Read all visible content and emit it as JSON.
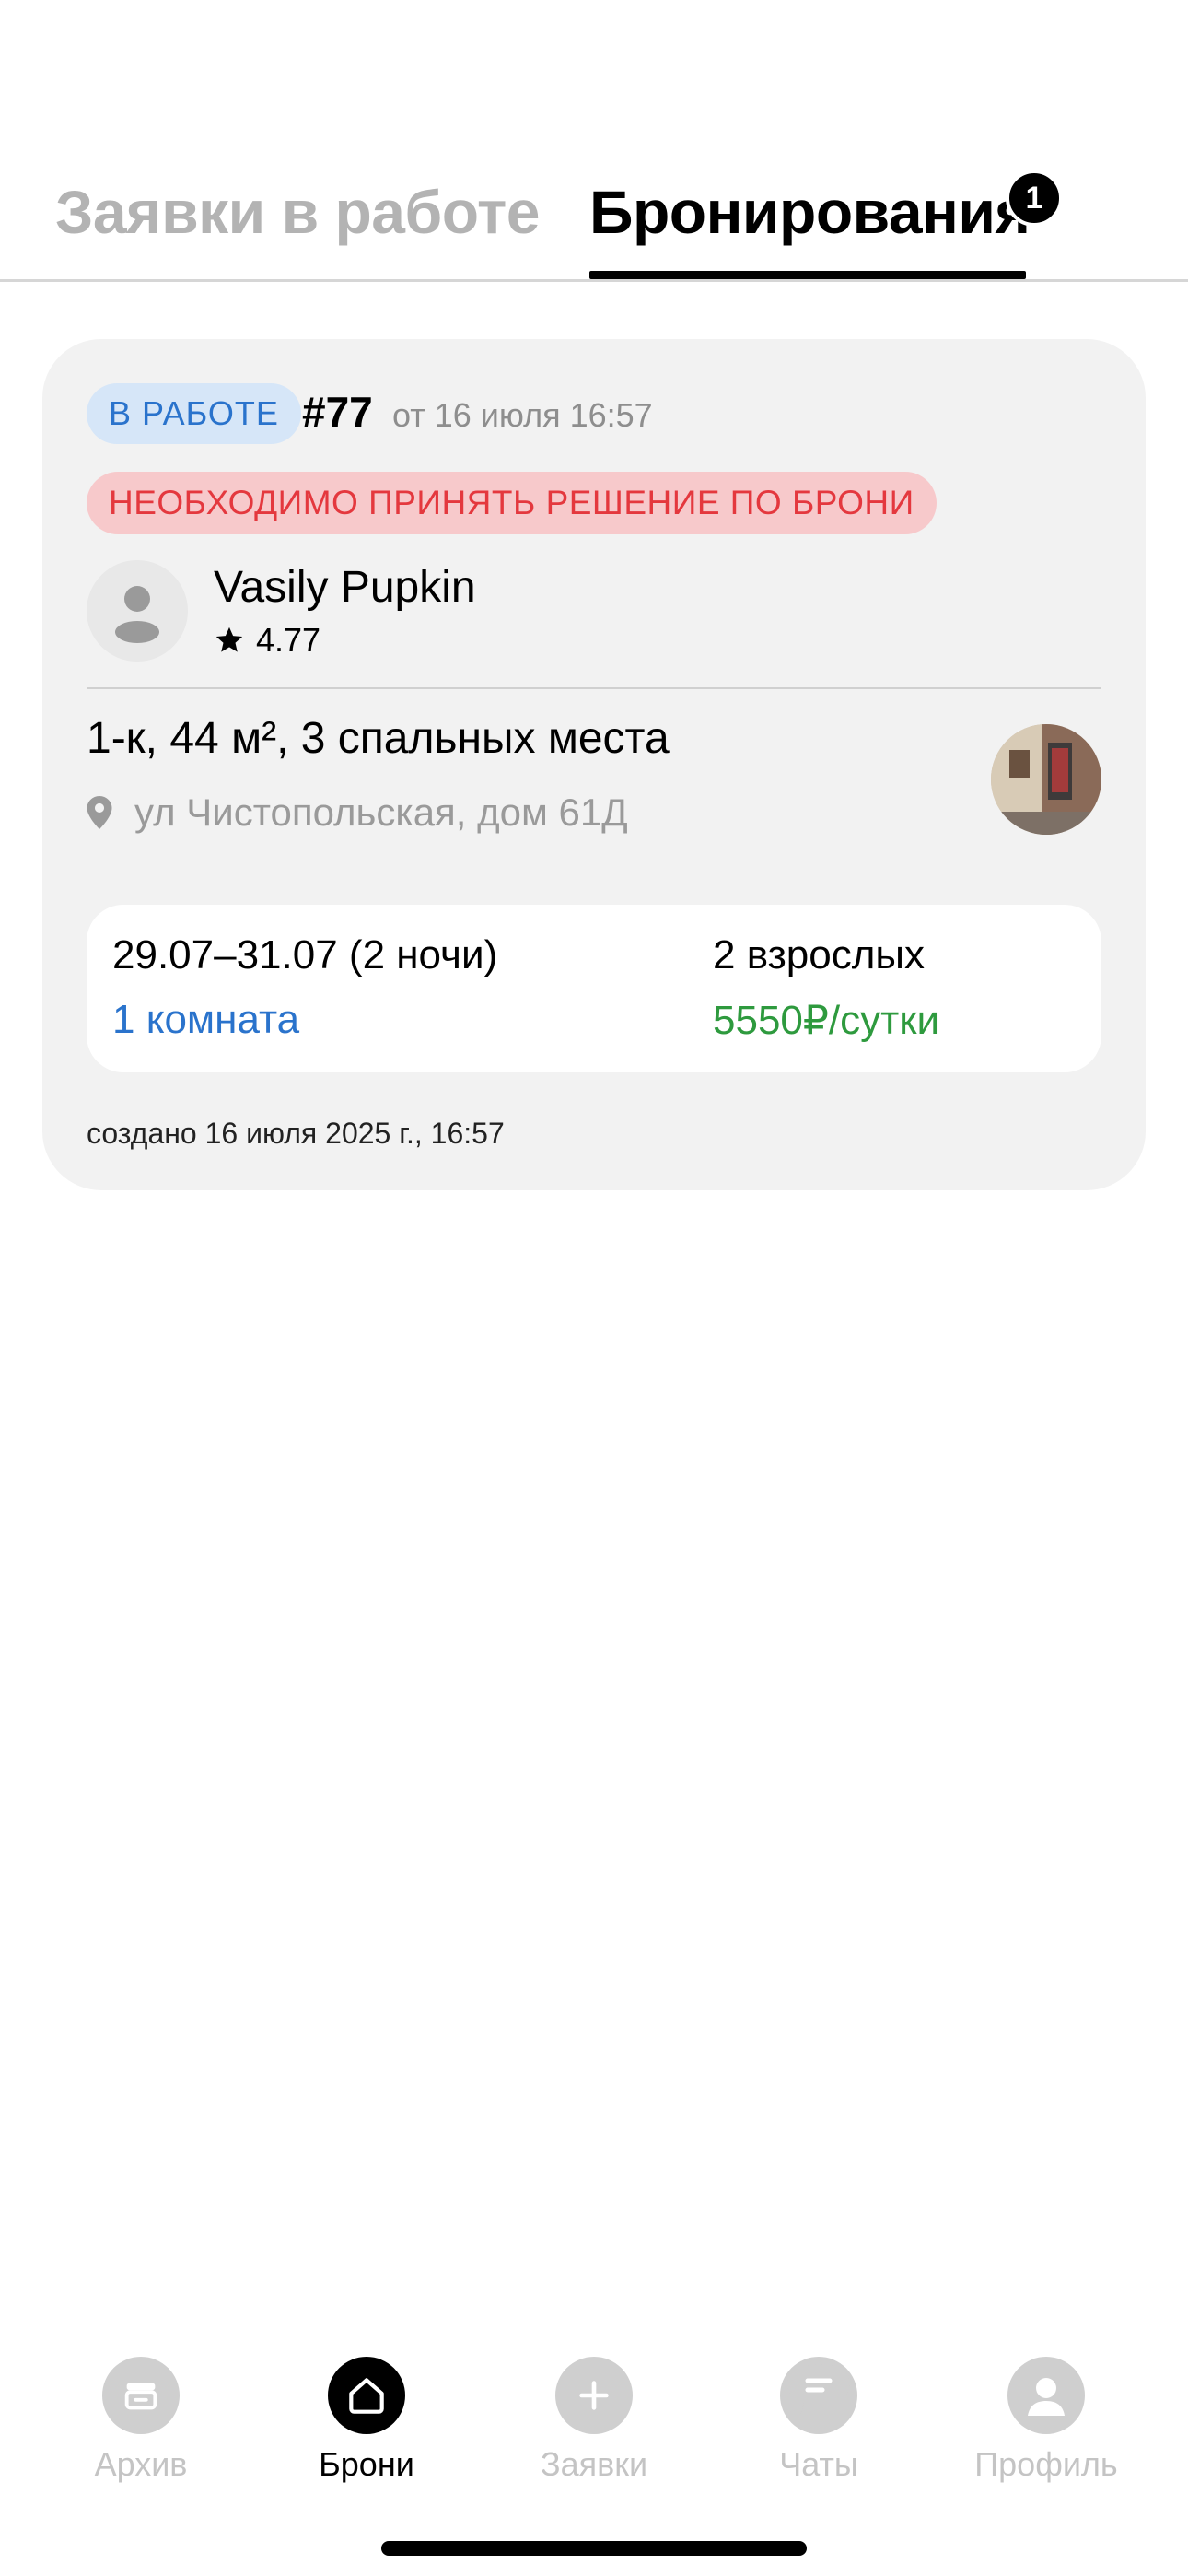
{
  "tabs": {
    "requests_label": "Заявки в работе",
    "bookings_label": "Бронирования",
    "bookings_badge": "1"
  },
  "booking": {
    "status": "В РАБОТЕ",
    "number": "#77",
    "date": "от 16 июля 16:57",
    "alert": "НЕОБХОДИМО ПРИНЯТЬ РЕШЕНИЕ ПО БРОНИ",
    "guest_name": "Vasily Pupkin",
    "guest_rating": "4.77",
    "apartment_title": "1-к, 44 м², 3 спальных места",
    "apartment_address": "ул Чистопольская, дом 61Д",
    "dates": "29.07–31.07 (2 ночи)",
    "guests": "2 взрослых",
    "rooms": "1 комната",
    "price": "5550₽/сутки",
    "created": "создано 16 июля 2025 г., 16:57"
  },
  "nav": {
    "archive": "Архив",
    "bookings": "Брони",
    "requests": "Заявки",
    "chats": "Чаты",
    "profile": "Профиль"
  },
  "colors": {
    "status_blue": "#2a73cc",
    "alert_red": "#e4383e",
    "price_green": "#2e9a3e"
  }
}
